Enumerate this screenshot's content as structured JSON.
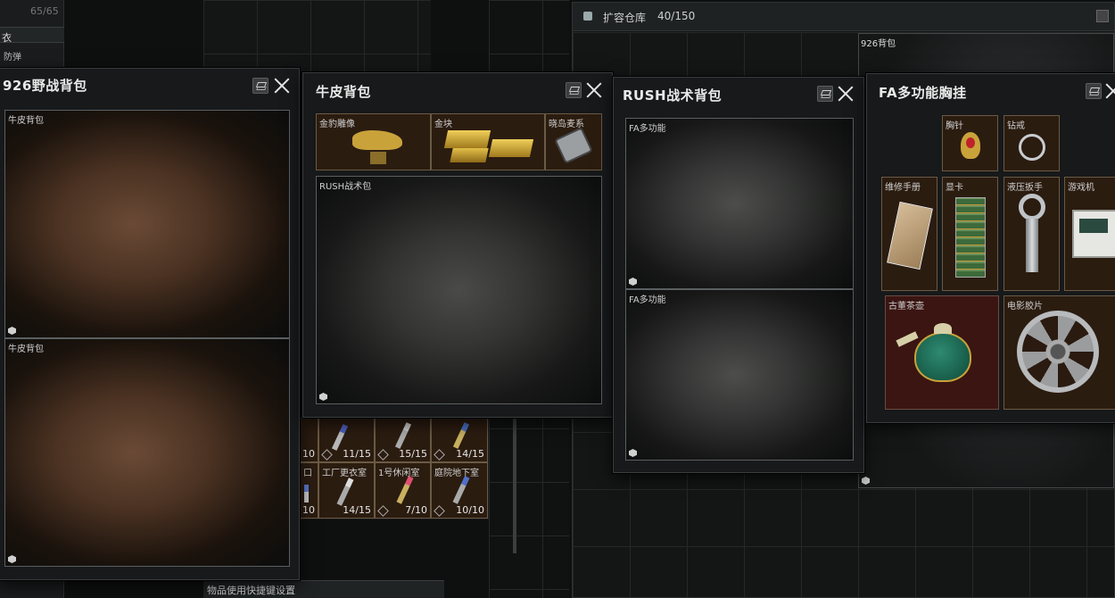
{
  "left_strip": {
    "count": "65/65",
    "row1": "衣",
    "row2": "防弹"
  },
  "bottom_hint": "物品使用快捷键设置",
  "expand_storage": {
    "title": "扩容仓库",
    "count": "40/150",
    "backpack_label": "926背包"
  },
  "keys": {
    "row1": [
      {
        "count": "10"
      },
      {
        "count": "11/15"
      },
      {
        "count": "15/15"
      },
      {
        "count": "14/15"
      }
    ],
    "row2": [
      {
        "label": "口",
        "count": "10"
      },
      {
        "label": "工厂更衣室",
        "count": "14/15"
      },
      {
        "label": "1号休闲室",
        "count": "7/10"
      },
      {
        "label": "庭院地下室",
        "count": "10/10"
      }
    ]
  },
  "panel_926": {
    "title": "926野战背包",
    "items": [
      {
        "label": "牛皮背包"
      },
      {
        "label": "牛皮背包"
      }
    ]
  },
  "panel_cowhide": {
    "title": "牛皮背包",
    "items": [
      {
        "label": "金豹雕像"
      },
      {
        "label": "金块"
      },
      {
        "label": "晓岛麦系"
      },
      {
        "label": "RUSH战术包"
      }
    ]
  },
  "panel_rush": {
    "title": "RUSH战术背包",
    "items": [
      {
        "label": "FA多功能"
      },
      {
        "label": "FA多功能"
      }
    ]
  },
  "panel_fa": {
    "title": "FA多功能胸挂",
    "items": [
      {
        "label": "胸针"
      },
      {
        "label": "钻戒"
      },
      {
        "label": "维修手册"
      },
      {
        "label": "显卡"
      },
      {
        "label": "液压扳手"
      },
      {
        "label": "游戏机"
      },
      {
        "label": "古董茶壶"
      },
      {
        "label": "电影胶片"
      }
    ]
  },
  "colors": {
    "slot_brown": "#2b1c10",
    "slot_red": "#3a1512",
    "accent_gold": "#c9a23a"
  }
}
